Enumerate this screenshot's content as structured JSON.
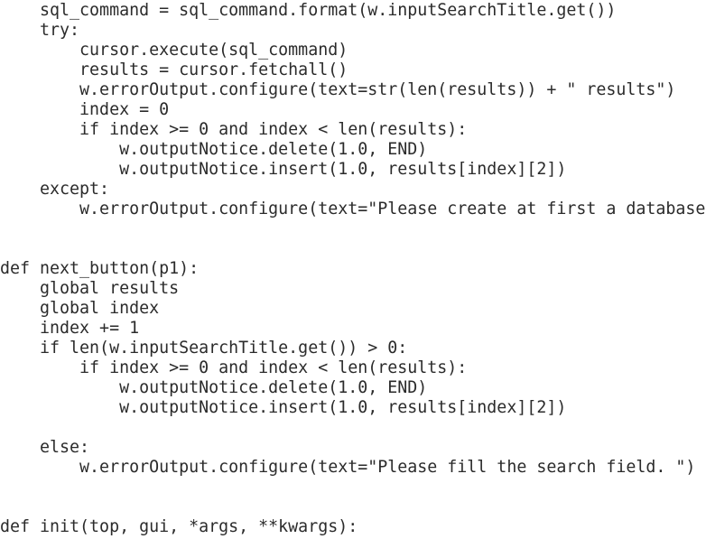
{
  "editor": {
    "lines": [
      "    sql_command = sql_command.format(w.inputSearchTitle.get())",
      "    try:",
      "        cursor.execute(sql_command)",
      "        results = cursor.fetchall()",
      "        w.errorOutput.configure(text=str(len(results)) + \" results\")",
      "        index = 0",
      "        if index >= 0 and index < len(results):",
      "            w.outputNotice.delete(1.0, END)",
      "            w.outputNotice.insert(1.0, results[index][2])",
      "    except:",
      "        w.errorOutput.configure(text=\"Please create at first a database",
      "",
      "",
      "def next_button(p1):",
      "    global results",
      "    global index",
      "    index += 1",
      "    if len(w.inputSearchTitle.get()) > 0:",
      "        if index >= 0 and index < len(results):",
      "            w.outputNotice.delete(1.0, END)",
      "            w.outputNotice.insert(1.0, results[index][2])",
      "",
      "    else:",
      "        w.errorOutput.configure(text=\"Please fill the search field. \")",
      "",
      "",
      "def init(top, gui, *args, **kwargs):"
    ]
  }
}
